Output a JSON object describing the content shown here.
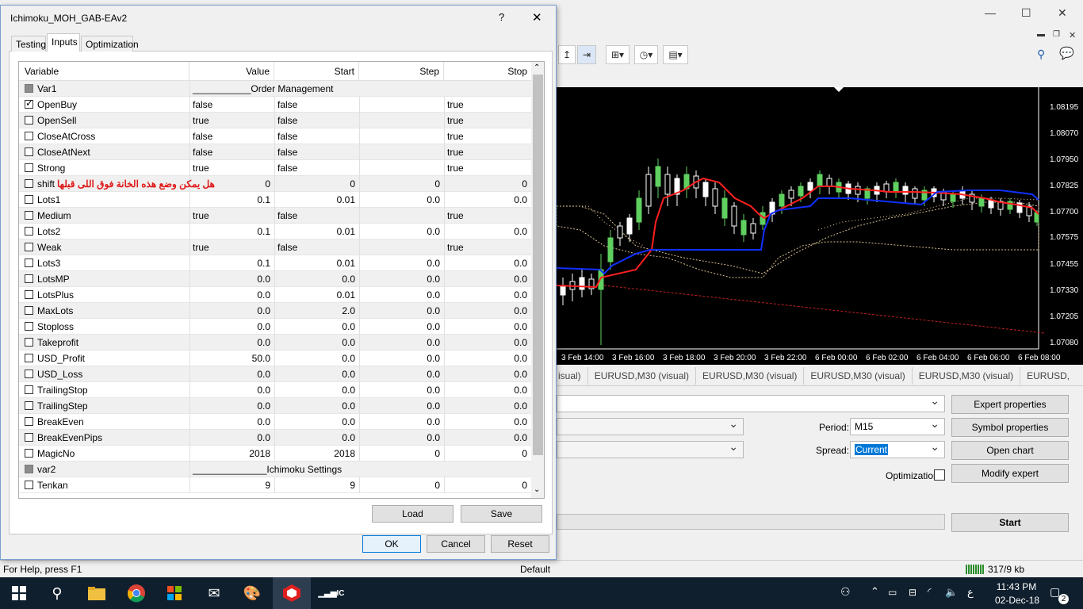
{
  "main": {
    "chart": {
      "prices": [
        "1.08195",
        "1.08070",
        "1.07950",
        "1.07825",
        "1.07700",
        "1.07575",
        "1.07455",
        "1.07330",
        "1.07205",
        "1.07080"
      ],
      "times": [
        "3 Feb 14:00",
        "3 Feb 16:00",
        "3 Feb 18:00",
        "3 Feb 20:00",
        "3 Feb 22:00",
        "6 Feb 00:00",
        "6 Feb 02:00",
        "6 Feb 04:00",
        "6 Feb 06:00",
        "6 Feb 08:00"
      ]
    },
    "chart_tabs": [
      "isual)",
      "EURUSD,M30 (visual)",
      "EURUSD,M30 (visual)",
      "EURUSD,M30 (visual)",
      "EURUSD,M30 (visual)",
      "EURUSD,"
    ],
    "tester": {
      "expert_properties": "Expert properties",
      "symbol_properties": "Symbol properties",
      "open_chart": "Open chart",
      "modify_expert": "Modify expert",
      "start": "Start",
      "period_label": "Period:",
      "period_value": "M15",
      "spread_label": "Spread:",
      "spread_value": "Current",
      "optimization_label": "Optimization"
    },
    "status": {
      "help": "For Help, press F1",
      "profile": "Default",
      "traffic": "317/9 kb"
    }
  },
  "taskbar": {
    "time": "11:43 PM",
    "date": "02-Dec-18",
    "lang": "ع",
    "notifications": "2"
  },
  "dialog": {
    "title": "Ichimoku_MOH_GAB-EAv2",
    "help": "?",
    "close": "✕",
    "tabs": [
      "Testing",
      "Inputs",
      "Optimization"
    ],
    "columns": [
      "Variable",
      "Value",
      "Start",
      "Step",
      "Stop"
    ],
    "note": "هل يمكن وضع هذه الخانة فوق اللى قبلها",
    "rows": [
      {
        "name": "Var1",
        "value": "___________Order Management",
        "start": "",
        "step": "",
        "stop": "",
        "check": "grey",
        "span": true
      },
      {
        "name": "OpenBuy",
        "value": "false",
        "start": "false",
        "step": "",
        "stop": "true",
        "check": "checked",
        "text": true
      },
      {
        "name": "OpenSell",
        "value": "true",
        "start": "false",
        "step": "",
        "stop": "true",
        "check": "",
        "text": true
      },
      {
        "name": "CloseAtCross",
        "value": "false",
        "start": "false",
        "step": "",
        "stop": "true",
        "check": "",
        "text": true
      },
      {
        "name": "CloseAtNext",
        "value": "false",
        "start": "false",
        "step": "",
        "stop": "true",
        "check": "",
        "text": true
      },
      {
        "name": "Strong",
        "value": "true",
        "start": "false",
        "step": "",
        "stop": "true",
        "check": "",
        "text": true
      },
      {
        "name": "shift",
        "value": "0",
        "start": "0",
        "step": "0",
        "stop": "0",
        "check": ""
      },
      {
        "name": "Lots1",
        "value": "0.1",
        "start": "0.01",
        "step": "0.0",
        "stop": "0.0",
        "check": ""
      },
      {
        "name": "Medium",
        "value": "true",
        "start": "false",
        "step": "",
        "stop": "true",
        "check": "",
        "text": true
      },
      {
        "name": "Lots2",
        "value": "0.1",
        "start": "0.01",
        "step": "0.0",
        "stop": "0.0",
        "check": ""
      },
      {
        "name": "Weak",
        "value": "true",
        "start": "false",
        "step": "",
        "stop": "true",
        "check": "",
        "text": true
      },
      {
        "name": "Lots3",
        "value": "0.1",
        "start": "0.01",
        "step": "0.0",
        "stop": "0.0",
        "check": ""
      },
      {
        "name": "LotsMP",
        "value": "0.0",
        "start": "0.0",
        "step": "0.0",
        "stop": "0.0",
        "check": ""
      },
      {
        "name": "LotsPlus",
        "value": "0.0",
        "start": "0.01",
        "step": "0.0",
        "stop": "0.0",
        "check": ""
      },
      {
        "name": "MaxLots",
        "value": "0.0",
        "start": "2.0",
        "step": "0.0",
        "stop": "0.0",
        "check": ""
      },
      {
        "name": "Stoploss",
        "value": "0.0",
        "start": "0.0",
        "step": "0.0",
        "stop": "0.0",
        "check": ""
      },
      {
        "name": "Takeprofit",
        "value": "0.0",
        "start": "0.0",
        "step": "0.0",
        "stop": "0.0",
        "check": ""
      },
      {
        "name": "USD_Profit",
        "value": "50.0",
        "start": "0.0",
        "step": "0.0",
        "stop": "0.0",
        "check": ""
      },
      {
        "name": "USD_Loss",
        "value": "0.0",
        "start": "0.0",
        "step": "0.0",
        "stop": "0.0",
        "check": ""
      },
      {
        "name": "TrailingStop",
        "value": "0.0",
        "start": "0.0",
        "step": "0.0",
        "stop": "0.0",
        "check": ""
      },
      {
        "name": "TrailingStep",
        "value": "0.0",
        "start": "0.0",
        "step": "0.0",
        "stop": "0.0",
        "check": ""
      },
      {
        "name": "BreakEven",
        "value": "0.0",
        "start": "0.0",
        "step": "0.0",
        "stop": "0.0",
        "check": ""
      },
      {
        "name": "BreakEvenPips",
        "value": "0.0",
        "start": "0.0",
        "step": "0.0",
        "stop": "0.0",
        "check": ""
      },
      {
        "name": "MagicNo",
        "value": "2018",
        "start": "2018",
        "step": "0",
        "stop": "0",
        "check": ""
      },
      {
        "name": "var2",
        "value": "______________Ichimoku Settings",
        "start": "",
        "step": "",
        "stop": "",
        "check": "grey",
        "span": true
      },
      {
        "name": "Tenkan",
        "value": "9",
        "start": "9",
        "step": "0",
        "stop": "0",
        "check": ""
      }
    ],
    "load": "Load",
    "save": "Save",
    "ok": "OK",
    "cancel": "Cancel",
    "reset": "Reset"
  }
}
